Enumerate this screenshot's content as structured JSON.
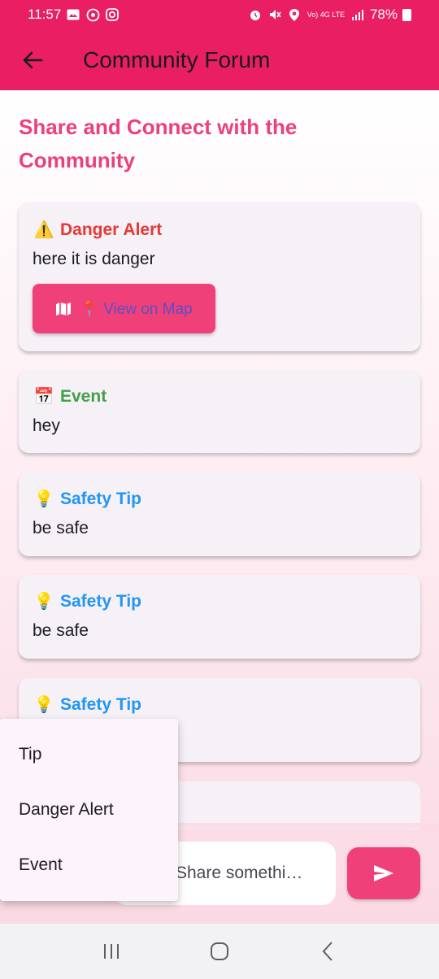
{
  "status_bar": {
    "time": "11:57",
    "network_label": "Vo) 4G LTE",
    "battery": "78%"
  },
  "app_bar": {
    "title": "Community Forum",
    "back_icon": "arrow-left-icon"
  },
  "headline": "Share and Connect with the Community",
  "posts": [
    {
      "type_label": "Danger Alert",
      "emoji": "⚠️",
      "body": "here it is danger",
      "button_label": "📍 View on Map",
      "accent": "#e53935"
    },
    {
      "type_label": "Event",
      "emoji": "📅",
      "body": "hey",
      "accent": "#43a047"
    },
    {
      "type_label": "Safety Tip",
      "emoji": "💡",
      "body": "be safe",
      "accent": "#2196f3"
    },
    {
      "type_label": "Safety Tip",
      "emoji": "💡",
      "body": "be safe",
      "accent": "#2196f3"
    },
    {
      "type_label": "Safety Tip",
      "emoji": "💡",
      "body": "",
      "accent": "#2196f3"
    }
  ],
  "dropdown": {
    "options": [
      "Tip",
      "Danger Alert",
      "Event"
    ]
  },
  "composer": {
    "placeholder": "Share somethi…",
    "send_icon": "send-icon"
  },
  "colors": {
    "primary": "#e91e63",
    "accent": "#f0407a",
    "headline": "#ec407a"
  }
}
